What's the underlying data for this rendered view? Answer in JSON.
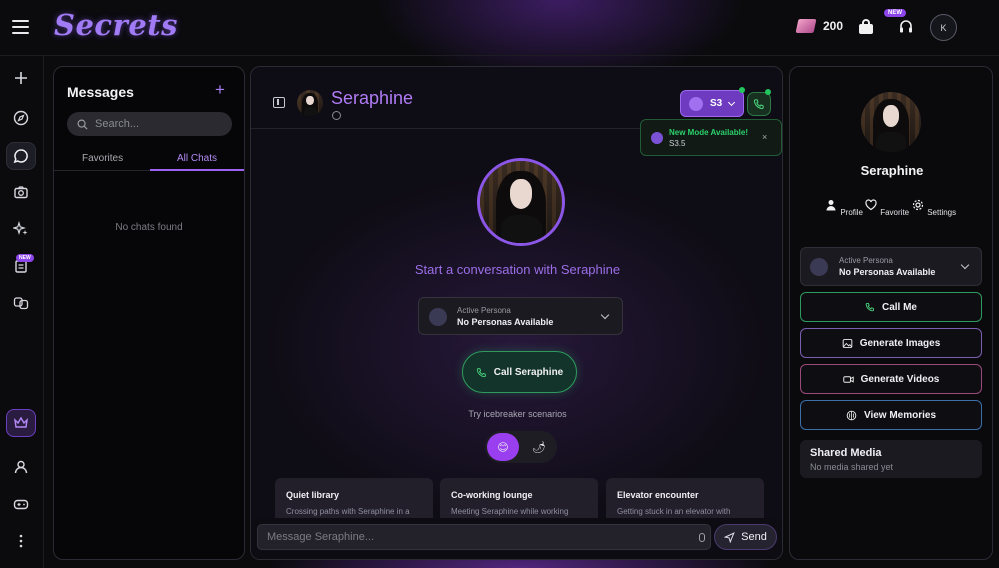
{
  "brand": {
    "logo": "Secrets"
  },
  "header": {
    "credits": "200",
    "new_badge": "NEW",
    "avatar_initial": "K"
  },
  "rail": {
    "new_badge": "NEW"
  },
  "messages": {
    "title": "Messages",
    "search_placeholder": "Search...",
    "tabs": [
      {
        "label": "Favorites"
      },
      {
        "label": "All Chats"
      }
    ],
    "active_tab": "All Chats",
    "empty_text": "No chats found"
  },
  "chat": {
    "character_name": "Seraphine",
    "model_label": "S3",
    "toast": {
      "title": "New Mode Available!",
      "subtitle": "S3.5"
    },
    "start_text": "Start a conversation with Seraphine",
    "persona": {
      "label": "Active Persona",
      "value": "No Personas Available"
    },
    "call_label": "Call Seraphine",
    "icebreaker_text": "Try icebreaker scenarios",
    "scenarios": [
      {
        "title": "Quiet library",
        "desc": "Crossing paths with Seraphine in a"
      },
      {
        "title": "Co-working lounge",
        "desc": "Meeting Seraphine while working"
      },
      {
        "title": "Elevator encounter",
        "desc": "Getting stuck in an elevator with"
      }
    ],
    "input_placeholder": "Message Seraphine...",
    "send_label": "Send"
  },
  "profile": {
    "name": "Seraphine",
    "actions": [
      {
        "label": "Profile"
      },
      {
        "label": "Favorite"
      },
      {
        "label": "Settings"
      }
    ],
    "persona": {
      "label": "Active Persona",
      "value": "No Personas Available"
    },
    "buttons": [
      {
        "label": "Call Me",
        "border": "#2f9a5e"
      },
      {
        "label": "Generate Images",
        "border": "#7a5fb0"
      },
      {
        "label": "Generate Videos",
        "border": "#9a4a7a"
      },
      {
        "label": "View Memories",
        "border": "#3a6fa8"
      }
    ],
    "shared_title": "Shared Media",
    "shared_empty": "No media shared yet"
  },
  "colors": {
    "accent": "#a77cf2",
    "green": "#22c55e",
    "background": "#0b0b0e"
  }
}
